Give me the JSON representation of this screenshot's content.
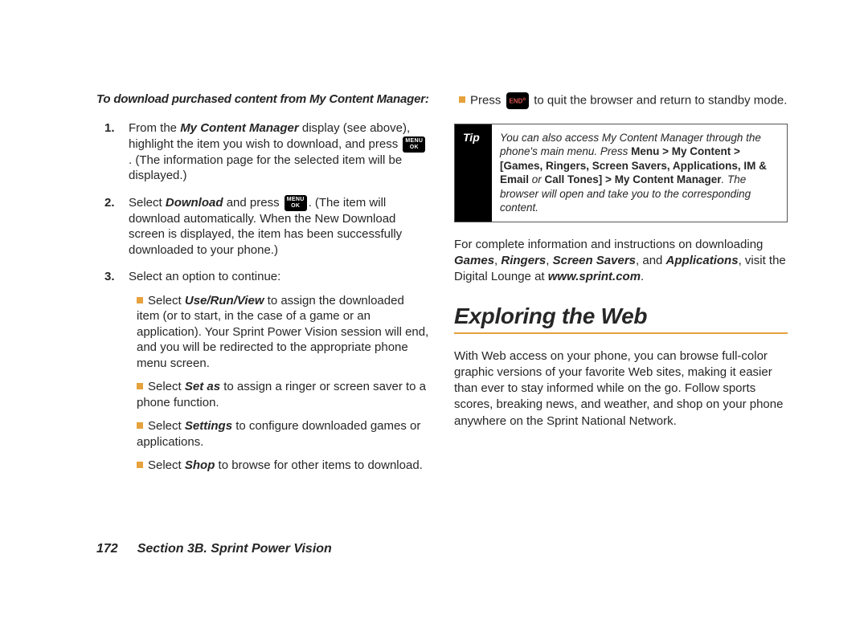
{
  "left": {
    "intro": "To download purchased content from My Content Manager:",
    "steps": [
      {
        "num": "1.",
        "pre": "From the ",
        "bold1": "My Content Manager",
        "mid1": " display (see above), highlight the item you wish to download, and press ",
        "key": "MENU\nOK",
        "post": ". (The information page for the selected item will be displayed.)"
      },
      {
        "num": "2.",
        "pre": "Select ",
        "bold1": "Download",
        "mid1": " and press ",
        "key": "MENU\nOK",
        "post": ". (The item will download automatically. When the New Download screen is displayed, the item has been successfully downloaded to your phone.)"
      },
      {
        "num": "3.",
        "text": "Select an option to continue:",
        "subs": [
          {
            "pre": "Select ",
            "bold": "Use/Run/View",
            "post": " to assign the downloaded item (or to start, in the case of a game or an application). Your Sprint Power Vision session will end, and you will be redirected to the appropriate phone menu screen."
          },
          {
            "pre": "Select ",
            "bold": "Set as",
            "post": " to assign a ringer or screen saver to a phone function."
          },
          {
            "pre": "Select ",
            "bold": "Settings",
            "post": " to configure downloaded games or applications."
          },
          {
            "pre": "Select ",
            "bold": "Shop",
            "post": " to browse for other items to download."
          }
        ]
      }
    ]
  },
  "right": {
    "top": {
      "pre": "Press ",
      "key": "END",
      "post": " to quit the browser and return to standby mode."
    },
    "tip": {
      "label": "Tip",
      "t1": "You can also access My Content Manager through the phone's main menu. Press ",
      "b1": "Menu > My Content > [Games, Ringers, Screen Savers, Applications, IM & Email ",
      "i2": "or",
      "b2": " Call Tones] > My Content Manager",
      "t2": ". The browser will open and take you to the corresponding content."
    },
    "after": {
      "t1": "For complete information and instructions on downloading ",
      "b1": "Games",
      "t2": ", ",
      "b2": "Ringers",
      "t3": ", ",
      "b3": "Screen Savers",
      "t4": ", and ",
      "b4": "Applications",
      "t5": ", visit the Digital Lounge at ",
      "b5": "www.sprint.com",
      "t6": "."
    },
    "heading": "Exploring the Web",
    "body": "With Web access on your phone, you can browse full-color graphic versions of your favorite Web sites, making it easier than ever to stay informed while on the go. Follow sports scores, breaking news, and weather, and shop on your phone anywhere on the Sprint National Network."
  },
  "footer": {
    "page": "172",
    "title": "Section 3B. Sprint Power Vision"
  }
}
